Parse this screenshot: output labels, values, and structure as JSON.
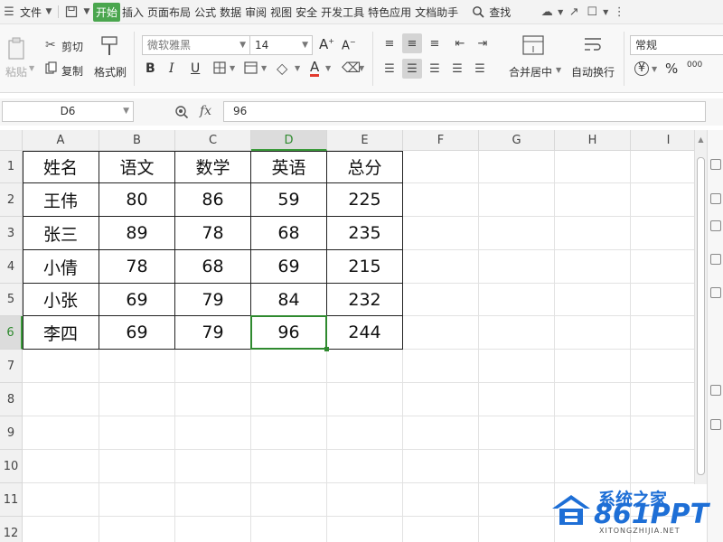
{
  "menu": {
    "file": "文件",
    "tabs": [
      "开始",
      "插入",
      "页面布局",
      "公式",
      "数据",
      "审阅",
      "视图",
      "安全",
      "开发工具",
      "特色应用",
      "文档助手"
    ],
    "active_tab": "开始",
    "search": "查找"
  },
  "ribbon": {
    "paste": "粘贴",
    "cut": "剪切",
    "copy": "复制",
    "format_painter": "格式刷",
    "font_name": "微软雅黑",
    "font_size": "14",
    "bold": "B",
    "italic": "I",
    "underline": "U",
    "merge_center": "合并居中",
    "wrap_text": "自动换行",
    "number_format": "常规",
    "percent": "%",
    "currency": "¥",
    "thousands": "000",
    "font_color_letter": "A"
  },
  "formula_bar": {
    "name_box": "D6",
    "fx": "fx",
    "value": "96"
  },
  "grid": {
    "columns": [
      "A",
      "B",
      "C",
      "D",
      "E",
      "F",
      "G",
      "H",
      "I"
    ],
    "rows": [
      "1",
      "2",
      "3",
      "4",
      "5",
      "6",
      "7",
      "8",
      "9",
      "10",
      "11",
      "12"
    ],
    "selected_column": "D",
    "selected_row": "6",
    "table": {
      "headers": [
        "姓名",
        "语文",
        "数学",
        "英语",
        "总分"
      ],
      "rows": [
        [
          "王伟",
          "80",
          "86",
          "59",
          "225"
        ],
        [
          "张三",
          "89",
          "78",
          "68",
          "235"
        ],
        [
          "小倩",
          "78",
          "68",
          "69",
          "215"
        ],
        [
          "小张",
          "69",
          "79",
          "84",
          "232"
        ],
        [
          "李四",
          "69",
          "79",
          "96",
          "244"
        ]
      ]
    }
  },
  "watermark": {
    "line1": "系统之家",
    "line2": "861PPT",
    "line3": "XITONGZHIJIA.NET"
  },
  "colors": {
    "accent": "#4aa64e",
    "selection": "#2f8a2f"
  }
}
